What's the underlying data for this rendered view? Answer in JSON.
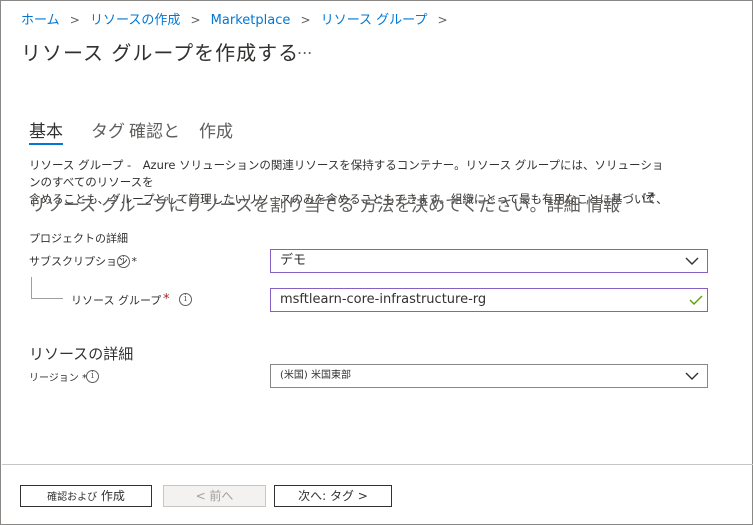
{
  "breadcrumb": {
    "items": [
      "ホーム",
      "リソースの作成",
      "Marketplace",
      "リソース グループ"
    ],
    "separator": ">"
  },
  "page": {
    "title": "リソース グループを作成する",
    "more_label": "..."
  },
  "tabs": [
    {
      "label": "基本",
      "active": true
    },
    {
      "label": "タグ",
      "active": false
    },
    {
      "label": "確認と",
      "active": false
    },
    {
      "label": "作成",
      "active": false
    }
  ],
  "description": {
    "line1": "リソース グループ -　Azure ソリューションの関連リソースを保持するコンテナー。リソース グループには、ソリューションのすべてのリソースを",
    "line2": "含めることも、グループとして管理したいリソースのみを含めることもできます。組織にとって最も有用なことに基づいて、",
    "line3": "リソース グループにリソースを割り当てる 方法を決めてください。詳細 情報"
  },
  "project_details": {
    "heading": "プロジェクトの詳細",
    "subscription_label": "サブスクリプション *",
    "subscription_value": "デモ",
    "resource_group_label": "リソース グループ",
    "resource_group_required": "*",
    "resource_group_value": "msftlearn-core-infrastructure-rg"
  },
  "resource_details": {
    "heading": "リソースの詳細",
    "region_label": "リージョン *",
    "region_value": "(米国) 米国東部"
  },
  "footer": {
    "review_prefix": "確認および",
    "review_label": "作成",
    "prev_label": "< 前へ",
    "next_label": "次へ: タグ >"
  },
  "colors": {
    "accent": "#0078d4",
    "focus_border": "#8661c5",
    "required": "#a4262c",
    "valid_check": "#57a300"
  },
  "icons": [
    "info-icon",
    "chevron-down-icon",
    "checkmark-icon",
    "external-link-icon"
  ]
}
